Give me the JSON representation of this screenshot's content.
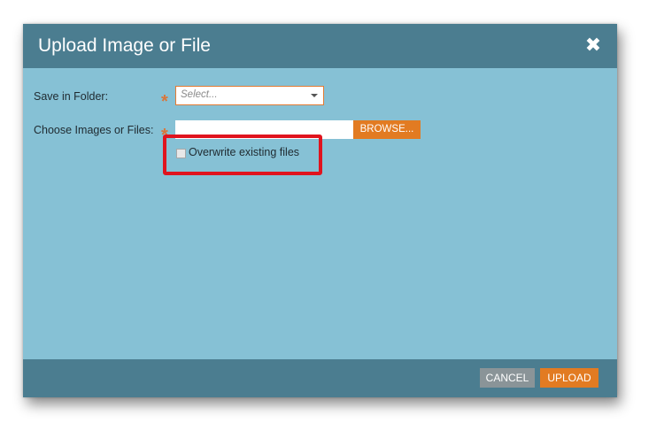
{
  "dialog": {
    "title": "Upload Image or File",
    "close_icon": "close-icon",
    "close_glyph": "✖"
  },
  "form": {
    "folder_label": "Save in Folder:",
    "folder_required": "*",
    "folder_placeholder": "Select...",
    "files_label": "Choose Images or Files:",
    "files_required": "*",
    "browse_label": "BROWSE...",
    "overwrite_label": "Overwrite existing files",
    "overwrite_checked": false
  },
  "footer": {
    "cancel_label": "CANCEL",
    "upload_label": "UPLOAD"
  },
  "colors": {
    "header": "#4b7d90",
    "body": "#86c1d5",
    "accent": "#e27b22",
    "highlight": "#e0141e",
    "cancel": "#8a9498"
  }
}
